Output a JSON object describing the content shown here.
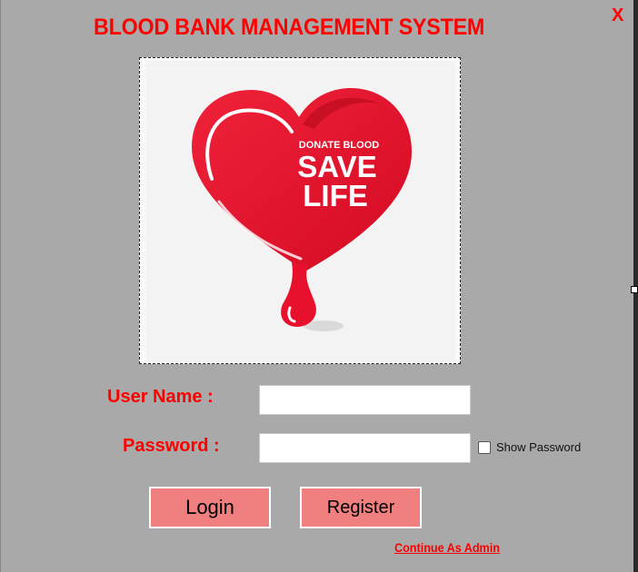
{
  "window": {
    "title": "BLOOD BANK MANAGEMENT SYSTEM",
    "close_label": "X"
  },
  "logo": {
    "line1": "DONATE BLOOD",
    "line2": "SAVE",
    "line3": "LIFE"
  },
  "form": {
    "username_label": "User Name :",
    "username_value": "",
    "password_label": "Password :",
    "password_value": "",
    "show_password_label": "Show Password",
    "show_password_checked": false
  },
  "buttons": {
    "login_label": "Login",
    "register_label": "Register",
    "admin_link_label": "Continue As Admin"
  },
  "colors": {
    "background": "#a9a9a9",
    "accent_red": "#ff0000",
    "button_fill": "#f08080",
    "heart_red": "#e8112d"
  }
}
